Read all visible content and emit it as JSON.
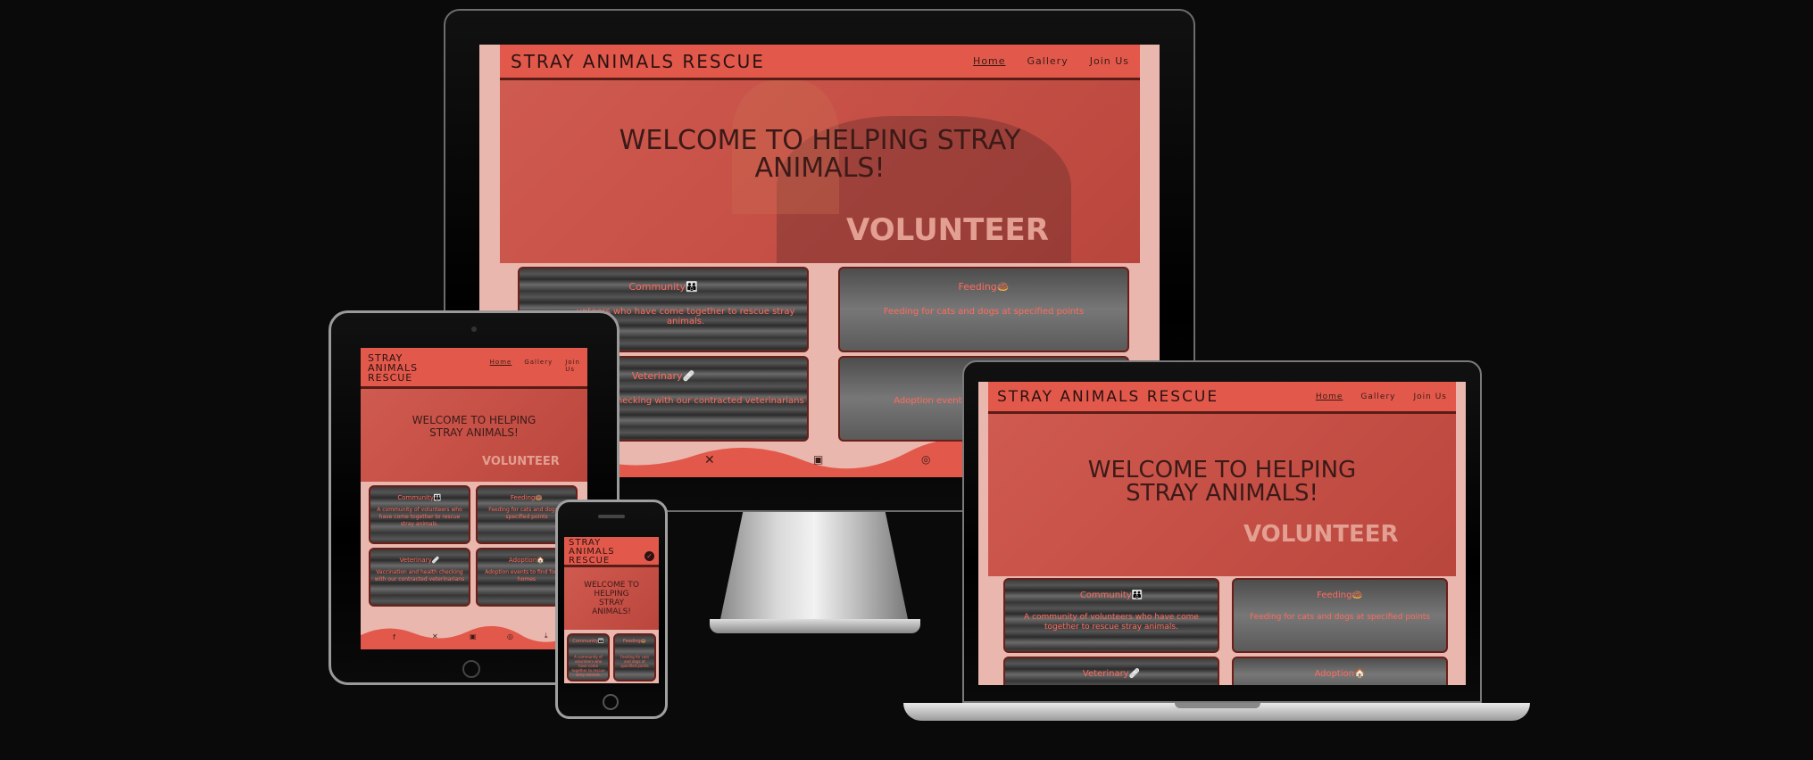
{
  "site": {
    "brand": "STRAY ANIMALS RESCUE",
    "brand_wrapped_1": "STRAY",
    "brand_wrapped_2": "ANIMALS",
    "brand_wrapped_3": "RESCUE",
    "nav": [
      "Home",
      "Gallery",
      "Join Us"
    ],
    "nav_tablet_join_1": "Join",
    "nav_tablet_join_2": "Us",
    "hero_title": "WELCOME TO HELPING STRAY ANIMALS!",
    "hero_line_1": "WELCOME TO HELPING STRAY",
    "hero_line_2": "ANIMALS!",
    "hero_laptop_line_1": "WELCOME TO HELPING",
    "hero_laptop_line_2": "STRAY ANIMALS!",
    "phone_hero_1": "WELCOME TO",
    "phone_hero_2": "HELPING",
    "phone_hero_3": "STRAY",
    "phone_hero_4": "ANIMALS!",
    "shirt": "VOLUNTEER",
    "cards": [
      {
        "title": "Community👪",
        "desc": "A community of volunteers who have come together to rescue stray animals."
      },
      {
        "title": "Feeding🍩",
        "desc": "Feeding for cats and dogs at specified points"
      },
      {
        "title": "Veterinary🩹",
        "desc": "Vaccination and health checking with our contracted veterinarians"
      },
      {
        "title": "Adoption🏠",
        "desc": "Adoption events to find forever homes"
      }
    ],
    "desktop_card1_desc_visible": "unteers who have come together to rescue stray animals.",
    "desktop_card3_desc_visible": "checking with our contracted veterinarians",
    "desktop_card4_desc_visible": "Adoption events",
    "tablet_card1_desc": "A community of volunteers who have come together to rescue stray animals.",
    "tablet_card2_desc": "Feeding for cats and dogs at specified points",
    "tablet_card3_desc": "Vaccination and health checking with our contracted veterinarians",
    "tablet_card4_desc": "Adoption events to find forever homes",
    "phone_card1_desc": "A community of volunteers who have come together to rescue stray animals.",
    "phone_card2_desc": "Feeding for cats and dogs at specified points",
    "footer_icons": [
      "facebook-icon",
      "x-icon",
      "youtube-icon",
      "instagram-icon",
      "download-icon"
    ]
  },
  "colors": {
    "accent": "#e2594b",
    "hero": "#c75147",
    "page_bg": "#e9b7ad",
    "card_text": "#ff6b5c",
    "backdrop": "#0b0a0a"
  }
}
